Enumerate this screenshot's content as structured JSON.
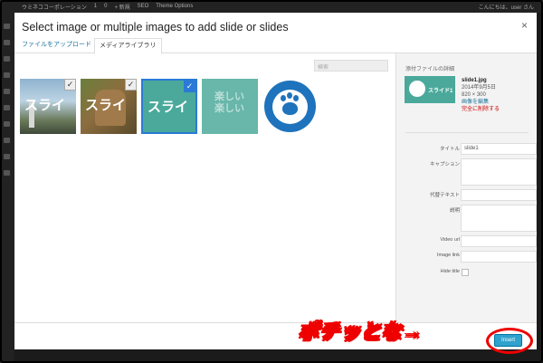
{
  "adminbar": {
    "items": [
      "ウミネココーポレーション",
      "1",
      "0",
      "+ 新規",
      "SEO",
      "Theme Options"
    ],
    "greeting": "こんにちは、user さん"
  },
  "modal": {
    "title": "Select image or multiple images to add slide or slides",
    "close_icon": "×",
    "tabs": {
      "upload": "ファイルをアップロード",
      "library": "メディアライブラリ"
    },
    "search_placeholder": "検索"
  },
  "thumbnails": [
    {
      "text": "スライ",
      "checked": true,
      "check_mark": "✓"
    },
    {
      "text": "スライ",
      "checked": true,
      "check_mark": "✓"
    },
    {
      "text": "スライ",
      "checked": true,
      "selected": true,
      "check_mark": "✓"
    },
    {
      "text": "楽しい 楽しい",
      "checked": false
    },
    {
      "text": "",
      "icon": "paw-logo",
      "checked": false
    }
  ],
  "details": {
    "heading": "添付ファイルの詳細",
    "thumb_text": "スライド1",
    "filename": "slide1.jpg",
    "date": "2014年9月5日",
    "dimensions": "820 × 300",
    "edit_link": "画像を編集",
    "delete_link": "完全に削除する",
    "fields": {
      "title_label": "タイトル",
      "title_value": "slide1",
      "caption_label": "キャプション",
      "alt_label": "代替テキスト",
      "description_label": "説明",
      "video_label": "Video url",
      "image_link_label": "Image link",
      "hide_title_label": "Hide title"
    }
  },
  "footer": {
    "insert_label": "Insert"
  },
  "annotation": "ポチッとな→",
  "colors": {
    "accent": "#2ea2cc",
    "highlight": "#e00000",
    "selected_border": "#2a7ad6"
  }
}
